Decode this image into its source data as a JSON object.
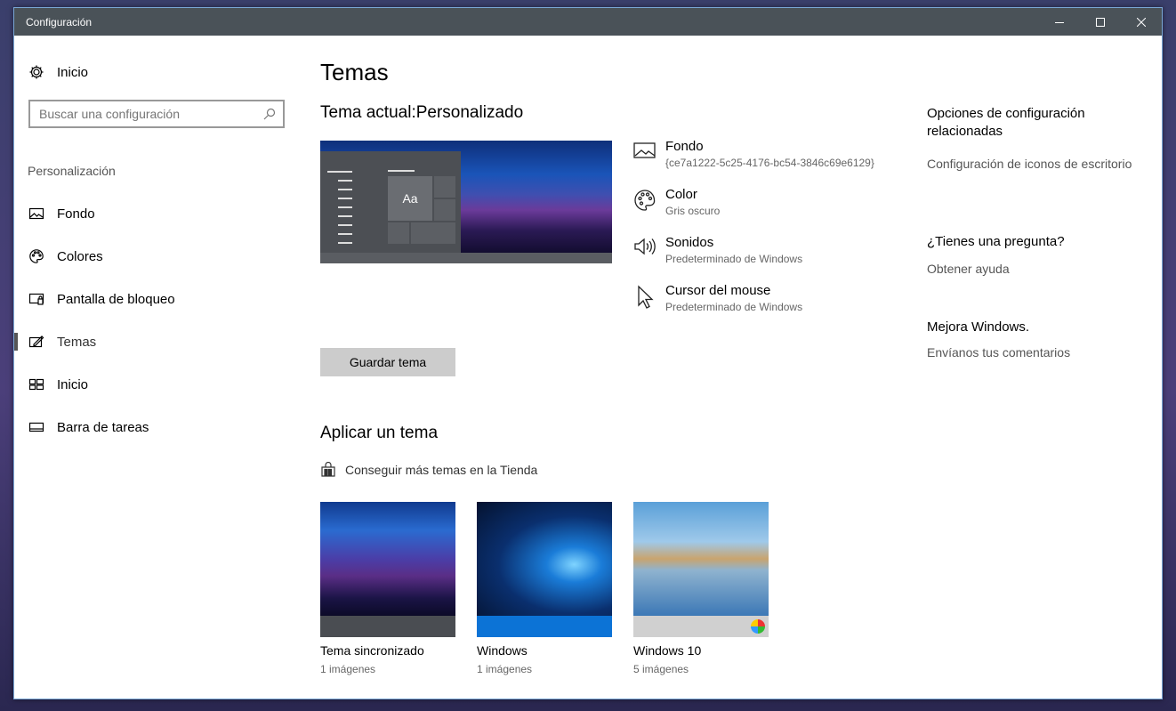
{
  "window": {
    "title": "Configuración"
  },
  "sidebar": {
    "home_label": "Inicio",
    "search_placeholder": "Buscar una configuración",
    "section": "Personalización",
    "items": [
      {
        "label": "Fondo",
        "icon": "image-icon"
      },
      {
        "label": "Colores",
        "icon": "palette-icon"
      },
      {
        "label": "Pantalla de bloqueo",
        "icon": "lock-screen-icon"
      },
      {
        "label": "Temas",
        "icon": "themes-icon",
        "active": true
      },
      {
        "label": "Inicio",
        "icon": "start-icon"
      },
      {
        "label": "Barra de tareas",
        "icon": "taskbar-icon"
      }
    ]
  },
  "main": {
    "title": "Temas",
    "current_label": "Tema actual:",
    "current_value": "Personalizado",
    "preview_text": "Aa",
    "properties": [
      {
        "name": "Fondo",
        "value": "{ce7a1222-5c25-4176-bc54-3846c69e6129}",
        "icon": "image-icon"
      },
      {
        "name": "Color",
        "value": "Gris oscuro",
        "icon": "palette-icon"
      },
      {
        "name": "Sonidos",
        "value": "Predeterminado de Windows",
        "icon": "speaker-icon"
      },
      {
        "name": "Cursor del mouse",
        "value": "Predeterminado de Windows",
        "icon": "cursor-icon"
      }
    ],
    "save_button": "Guardar tema",
    "apply_title": "Aplicar un tema",
    "store_link": "Conseguir más temas en la Tienda",
    "themes": [
      {
        "name": "Tema sincronizado",
        "count": "1 imágenes"
      },
      {
        "name": "Windows",
        "count": "1 imágenes"
      },
      {
        "name": "Windows 10",
        "count": "5 imágenes"
      }
    ]
  },
  "right": {
    "related_title": "Opciones de configuración relacionadas",
    "related_link": "Configuración de iconos de escritorio",
    "question_title": "¿Tienes una pregunta?",
    "question_link": "Obtener ayuda",
    "improve_title": "Mejora Windows.",
    "improve_link": "Envíanos tus comentarios"
  }
}
